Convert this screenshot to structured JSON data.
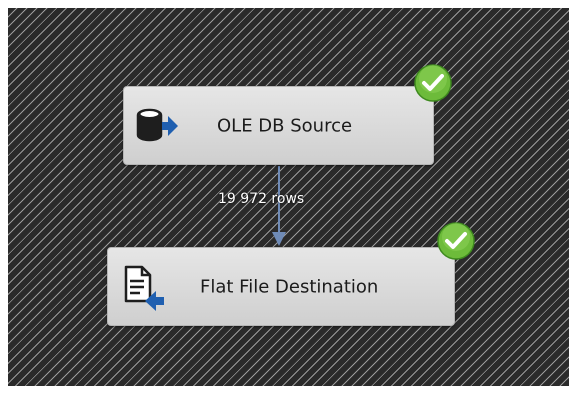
{
  "dataflow": {
    "source": {
      "label": "OLE DB Source",
      "icon": "database-source-icon",
      "status": "success"
    },
    "path": {
      "rows_label": "19 972 rows",
      "color": "#6f8bb7"
    },
    "destination": {
      "label": "Flat File Destination",
      "icon": "flat-file-destination-icon",
      "status": "success"
    }
  },
  "colors": {
    "success": "#6dbb3a",
    "arrow": "#1f5fb0"
  }
}
